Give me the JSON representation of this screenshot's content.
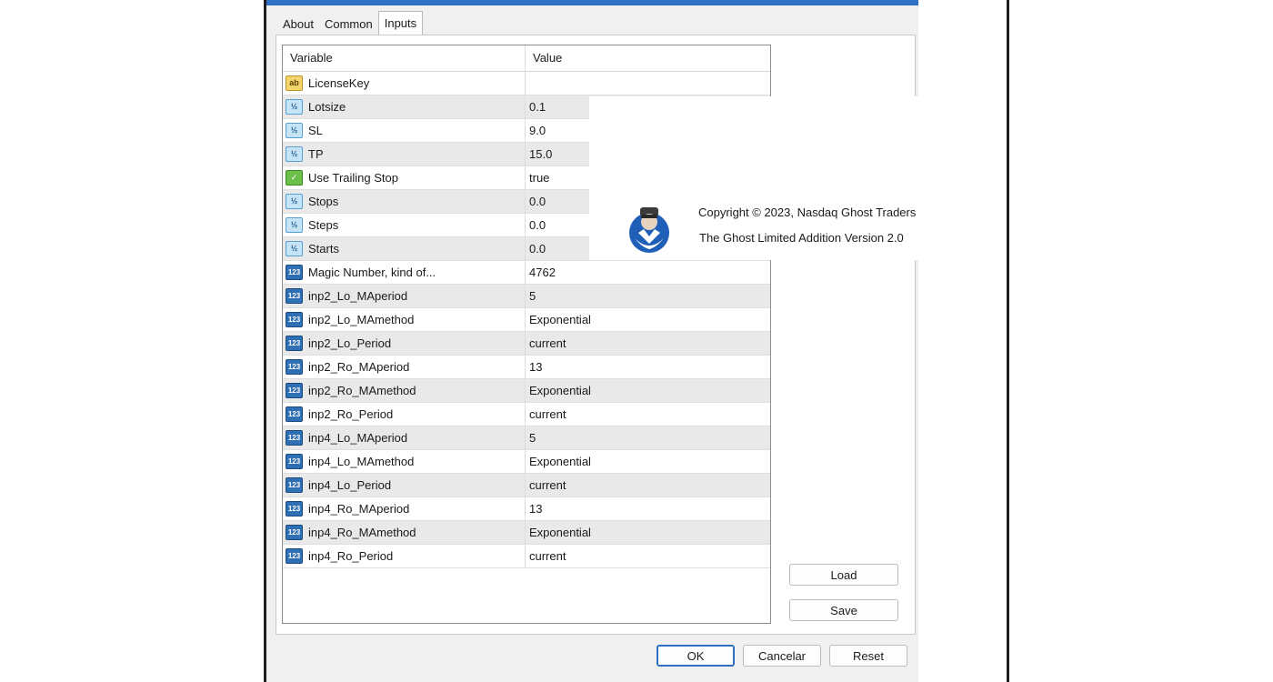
{
  "tabs": [
    {
      "label": "About"
    },
    {
      "label": "Common"
    },
    {
      "label": "Inputs",
      "active": true
    }
  ],
  "grid": {
    "headers": {
      "variable": "Variable",
      "value": "Value"
    },
    "rows": [
      {
        "icon": "string-type-icon",
        "glyph": "ab",
        "variable": "LicenseKey",
        "value": ""
      },
      {
        "icon": "double-type-icon",
        "glyph": "½",
        "variable": "Lotsize",
        "value": "0.1"
      },
      {
        "icon": "double-type-icon",
        "glyph": "½",
        "variable": "SL",
        "value": "9.0"
      },
      {
        "icon": "double-type-icon",
        "glyph": "½",
        "variable": "TP",
        "value": "15.0"
      },
      {
        "icon": "bool-type-icon",
        "glyph": "✓",
        "variable": "Use Trailing Stop",
        "value": "true"
      },
      {
        "icon": "double-type-icon",
        "glyph": "½",
        "variable": "Stops",
        "value": "0.0"
      },
      {
        "icon": "double-type-icon",
        "glyph": "½",
        "variable": "Steps",
        "value": "0.0"
      },
      {
        "icon": "double-type-icon",
        "glyph": "½",
        "variable": "Starts",
        "value": "0.0"
      },
      {
        "icon": "int-type-icon",
        "glyph": "123",
        "variable": "Magic Number, kind of...",
        "value": "4762"
      },
      {
        "icon": "int-type-icon",
        "glyph": "123",
        "variable": "inp2_Lo_MAperiod",
        "value": "5"
      },
      {
        "icon": "int-type-icon",
        "glyph": "123",
        "variable": "inp2_Lo_MAmethod",
        "value": "Exponential"
      },
      {
        "icon": "int-type-icon",
        "glyph": "123",
        "variable": "inp2_Lo_Period",
        "value": "current"
      },
      {
        "icon": "int-type-icon",
        "glyph": "123",
        "variable": "inp2_Ro_MAperiod",
        "value": "13"
      },
      {
        "icon": "int-type-icon",
        "glyph": "123",
        "variable": "inp2_Ro_MAmethod",
        "value": "Exponential"
      },
      {
        "icon": "int-type-icon",
        "glyph": "123",
        "variable": "inp2_Ro_Period",
        "value": "current"
      },
      {
        "icon": "int-type-icon",
        "glyph": "123",
        "variable": "inp4_Lo_MAperiod",
        "value": "5"
      },
      {
        "icon": "int-type-icon",
        "glyph": "123",
        "variable": "inp4_Lo_MAmethod",
        "value": "Exponential"
      },
      {
        "icon": "int-type-icon",
        "glyph": "123",
        "variable": "inp4_Lo_Period",
        "value": "current"
      },
      {
        "icon": "int-type-icon",
        "glyph": "123",
        "variable": "inp4_Ro_MAperiod",
        "value": "13"
      },
      {
        "icon": "int-type-icon",
        "glyph": "123",
        "variable": "inp4_Ro_MAmethod",
        "value": "Exponential"
      },
      {
        "icon": "int-type-icon",
        "glyph": "123",
        "variable": "inp4_Ro_Period",
        "value": "current"
      }
    ]
  },
  "info": {
    "copyright": "Copyright © 2023, Nasdaq Ghost Traders",
    "version": "The Ghost Limited Addition Version 2.0"
  },
  "side_buttons": {
    "load": "Load",
    "save": "Save"
  },
  "footer": {
    "ok": "OK",
    "cancel": "Cancelar",
    "reset": "Reset"
  },
  "colors": {
    "accent": "#2f6fc4",
    "window_bg": "#f0f0f0",
    "row_alt": "#e9e9e9"
  }
}
